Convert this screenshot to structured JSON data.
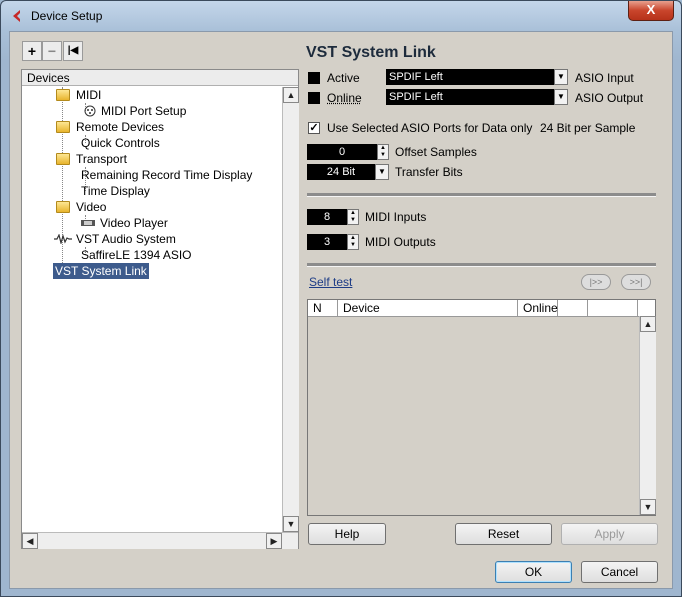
{
  "window": {
    "title": "Device Setup",
    "close_glyph": "X",
    "colors": {
      "accent": "#3d5b8c",
      "close": "#c9452c",
      "app_icon": "#c62828"
    }
  },
  "toolbar": {
    "add_glyph": "+",
    "remove_glyph": "−",
    "reset_glyph": "|◀"
  },
  "tree": {
    "header": "Devices",
    "items": [
      {
        "label": "MIDI",
        "icon": "folder-icon"
      },
      {
        "label": "MIDI Port Setup",
        "icon": "midi-port-icon"
      },
      {
        "label": "Remote Devices",
        "icon": "folder-icon"
      },
      {
        "label": "Quick Controls",
        "icon": ""
      },
      {
        "label": "Transport",
        "icon": "folder-icon"
      },
      {
        "label": "Remaining Record Time Display",
        "icon": ""
      },
      {
        "label": "Time Display",
        "icon": ""
      },
      {
        "label": "Video",
        "icon": "folder-icon"
      },
      {
        "label": "Video Player",
        "icon": "video-player-icon"
      },
      {
        "label": "VST Audio System",
        "icon": "audio-system-icon"
      },
      {
        "label": "SaffireLE 1394 ASIO",
        "icon": ""
      },
      {
        "label": "VST System Link",
        "icon": "",
        "selected": true
      }
    ]
  },
  "panel": {
    "heading": "VST System Link",
    "active_label": "Active",
    "active_input": "SPDIF Left",
    "asio_input_label": "ASIO Input",
    "online_label": "Online",
    "active_output": "SPDIF Left",
    "asio_output_label": "ASIO Output",
    "use_selected_label": "Use Selected ASIO Ports for Data only",
    "use_selected_checked": true,
    "bits_per_sample": "24 Bit per Sample",
    "offset_value": "0",
    "offset_label": "Offset Samples",
    "transfer_bits_value": "24 Bit",
    "transfer_bits_label": "Transfer Bits",
    "midi_inputs_value": "8",
    "midi_inputs_label": "MIDI Inputs",
    "midi_outputs_value": "3",
    "midi_outputs_label": "MIDI Outputs",
    "self_test": "Self test",
    "pill_left": "|>>",
    "pill_right": ">>|"
  },
  "table": {
    "columns": [
      "N",
      "Device",
      "Online",
      ""
    ],
    "rows": []
  },
  "buttons": {
    "help": "Help",
    "reset": "Reset",
    "apply": "Apply",
    "ok": "OK",
    "cancel": "Cancel"
  }
}
